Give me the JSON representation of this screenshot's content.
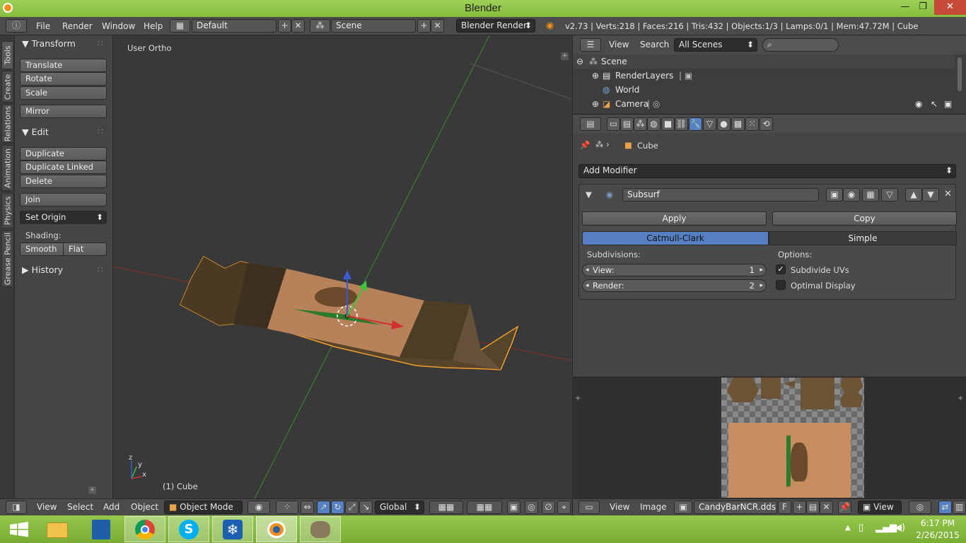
{
  "window": {
    "title": "Blender",
    "minimize": "—",
    "maximize": "❐",
    "close": "✕"
  },
  "info_header": {
    "menus": [
      "File",
      "Render",
      "Window",
      "Help"
    ],
    "layout": "Default",
    "scene": "Scene",
    "engine": "Blender Render",
    "stats": "v2.73 | Verts:218 | Faces:216 | Tris:432 | Objects:1/3 | Lamps:0/1 | Mem:47.72M | Cube"
  },
  "tool_tabs": [
    "Tools",
    "Create",
    "Relations",
    "Animation",
    "Physics",
    "Grease Pencil"
  ],
  "tool_panel": {
    "transform_title": "Transform",
    "translate": "Translate",
    "rotate": "Rotate",
    "scale": "Scale",
    "mirror": "Mirror",
    "edit_title": "Edit",
    "duplicate": "Duplicate",
    "duplicate_linked": "Duplicate Linked",
    "delete": "Delete",
    "join": "Join",
    "set_origin": "Set Origin",
    "shading_label": "Shading:",
    "smooth": "Smooth",
    "flat": "Flat",
    "history_title": "History"
  },
  "viewport": {
    "view_name": "User Ortho",
    "object_label": "(1) Cube",
    "axis_x": "x",
    "axis_y": "y",
    "axis_z": "z"
  },
  "viewport_header": {
    "menus": [
      "View",
      "Select",
      "Add",
      "Object"
    ],
    "mode": "Object Mode",
    "orientation": "Global"
  },
  "outliner": {
    "menus": [
      "View",
      "Search"
    ],
    "filter": "All Scenes",
    "items": [
      {
        "label": "Scene"
      },
      {
        "label": "RenderLayers"
      },
      {
        "label": "World"
      },
      {
        "label": "Camera"
      }
    ]
  },
  "properties": {
    "breadcrumb": "Cube",
    "add_modifier": "Add Modifier",
    "modifier_name": "Subsurf",
    "apply": "Apply",
    "copy": "Copy",
    "catmull_clark": "Catmull-Clark",
    "simple": "Simple",
    "subdivisions_label": "Subdivisions:",
    "view_label": "View:",
    "view_value": "1",
    "render_label": "Render:",
    "render_value": "2",
    "options_label": "Options:",
    "subdivide_uvs": "Subdivide UVs",
    "subdivide_uvs_checked": true,
    "optimal_display": "Optimal Display",
    "optimal_display_checked": false
  },
  "image_editor_header": {
    "menus": [
      "View",
      "Image"
    ],
    "image_name": "CandyBarNCR.dds",
    "fake_user": "F",
    "view_mode": "View"
  },
  "taskbar": {
    "time": "6:17 PM",
    "date": "2/26/2015",
    "apps": [
      "windows-start",
      "file-explorer",
      "task-manager",
      "chrome",
      "skype",
      "snowflake-app",
      "blender",
      "gimp"
    ]
  },
  "colors": {
    "accent_blue": "#5680c2",
    "selection_orange": "#f19e2c",
    "taskbar_green": "#86bf3e"
  }
}
